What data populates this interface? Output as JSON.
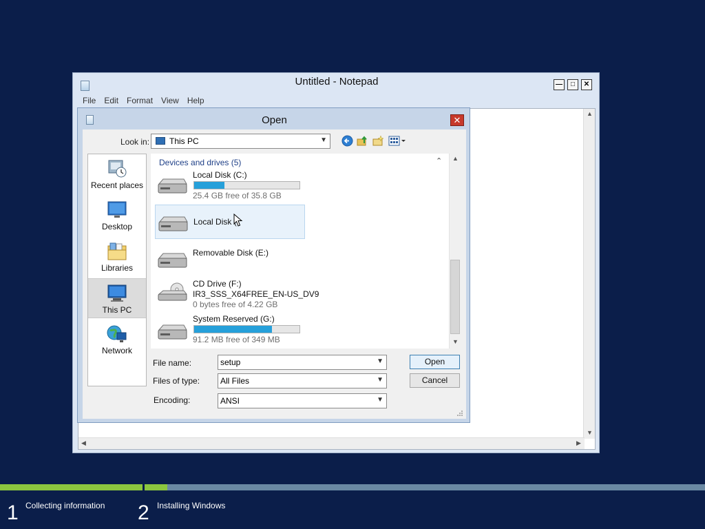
{
  "notepad": {
    "title": "Untitled - Notepad",
    "menu": [
      "File",
      "Edit",
      "Format",
      "View",
      "Help"
    ],
    "controls": {
      "minimize": "—",
      "maximize": "□",
      "close": "✕"
    }
  },
  "open_dialog": {
    "title": "Open",
    "close_glyph": "✕",
    "look_in_label": "Look in:",
    "look_in_value": "This PC",
    "places": [
      {
        "label": "Recent places",
        "icon": "recent-places-icon"
      },
      {
        "label": "Desktop",
        "icon": "desktop-icon"
      },
      {
        "label": "Libraries",
        "icon": "libraries-icon"
      },
      {
        "label": "This PC",
        "icon": "this-pc-icon",
        "selected": true
      },
      {
        "label": "Network",
        "icon": "network-icon"
      }
    ],
    "group_header": "Devices and drives (5)",
    "drives": [
      {
        "name": "Local Disk (C:)",
        "free": "25.4 GB free of 35.8 GB",
        "used_fraction": 0.29,
        "icon": "hard-disk-icon"
      },
      {
        "name": "Local Disk (",
        "free": "",
        "used_fraction": null,
        "icon": "hard-disk-icon",
        "hover": true
      },
      {
        "name": "Removable Disk (E:)",
        "free": "",
        "used_fraction": null,
        "icon": "removable-disk-icon"
      },
      {
        "name": "CD Drive (F:)",
        "label": "IR3_SSS_X64FREE_EN-US_DV9",
        "free": "0 bytes free of 4.22 GB",
        "used_fraction": null,
        "icon": "cd-drive-icon"
      },
      {
        "name": "System Reserved (G:)",
        "free": "91.2 MB free of 349 MB",
        "used_fraction": 0.74,
        "icon": "hard-disk-icon"
      }
    ],
    "file_name_label": "File name:",
    "file_name_value": "setup",
    "file_type_label": "Files of type:",
    "file_type_value": "All Files",
    "encoding_label": "Encoding:",
    "encoding_value": "ANSI",
    "open_button": "Open",
    "cancel_button": "Cancel"
  },
  "setup_progress": {
    "steps": [
      {
        "number": "1",
        "label": "Collecting information",
        "progress": 1.0
      },
      {
        "number": "2",
        "label": "Installing Windows",
        "progress": 0.04
      }
    ]
  },
  "colors": {
    "desktop_bg": "#0b1e4a",
    "progress_fill": "#8cc63f",
    "drive_bar_fill": "#26a0da",
    "dialog_close": "#c7392b"
  }
}
